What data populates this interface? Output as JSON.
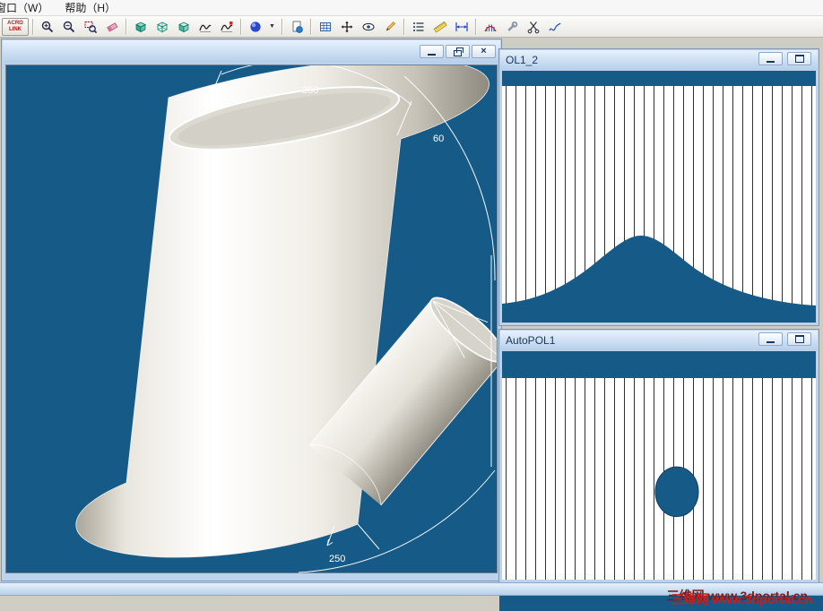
{
  "colors": {
    "viewport_blue": "#165a87",
    "frame_blue": "#bdd3ec",
    "titlebar_text": "#16365e",
    "mdi_gray": "#cfccc3",
    "pattern_line": "#303030",
    "watermark_red": "#c81e1e",
    "watermark_shadow": "#7c1b1b"
  },
  "menu": {
    "items": [
      {
        "label": "窗口（W）"
      },
      {
        "label": "帮助（H）"
      }
    ]
  },
  "toolbar": {
    "acrolink": {
      "line1": "ACRO",
      "line2": "LINK"
    },
    "dropdown_glyph": "▼",
    "icon_names": [
      "zoom-in-icon",
      "zoom-out-icon",
      "zoom-window-icon",
      "zoom-previous-icon",
      "shaded-view-icon",
      "wireframe-view-icon",
      "solid-view-icon",
      "curve-profile-icon",
      "curve-flag-icon",
      "material-color-icon",
      "dropdown-arrow-icon",
      "new-sheet-icon",
      "grid-icon",
      "pan-icon",
      "eye-icon",
      "pencil-icon",
      "list-icon",
      "ruler-icon",
      "linear-dimension-icon",
      "unfold-icon",
      "tools-icon",
      "scissors-icon",
      "sketch-icon"
    ]
  },
  "windows": {
    "main3d": {
      "title": "",
      "dims": {
        "top": "250",
        "angle": "60",
        "bottom": "250"
      }
    },
    "pattern_top": {
      "title": "OL1_2"
    },
    "pattern_bottom": {
      "title": "AutoPOL1"
    }
  },
  "window_controls": {
    "close_glyph": "×"
  },
  "watermark": "三维网 www.3dportal.cn"
}
